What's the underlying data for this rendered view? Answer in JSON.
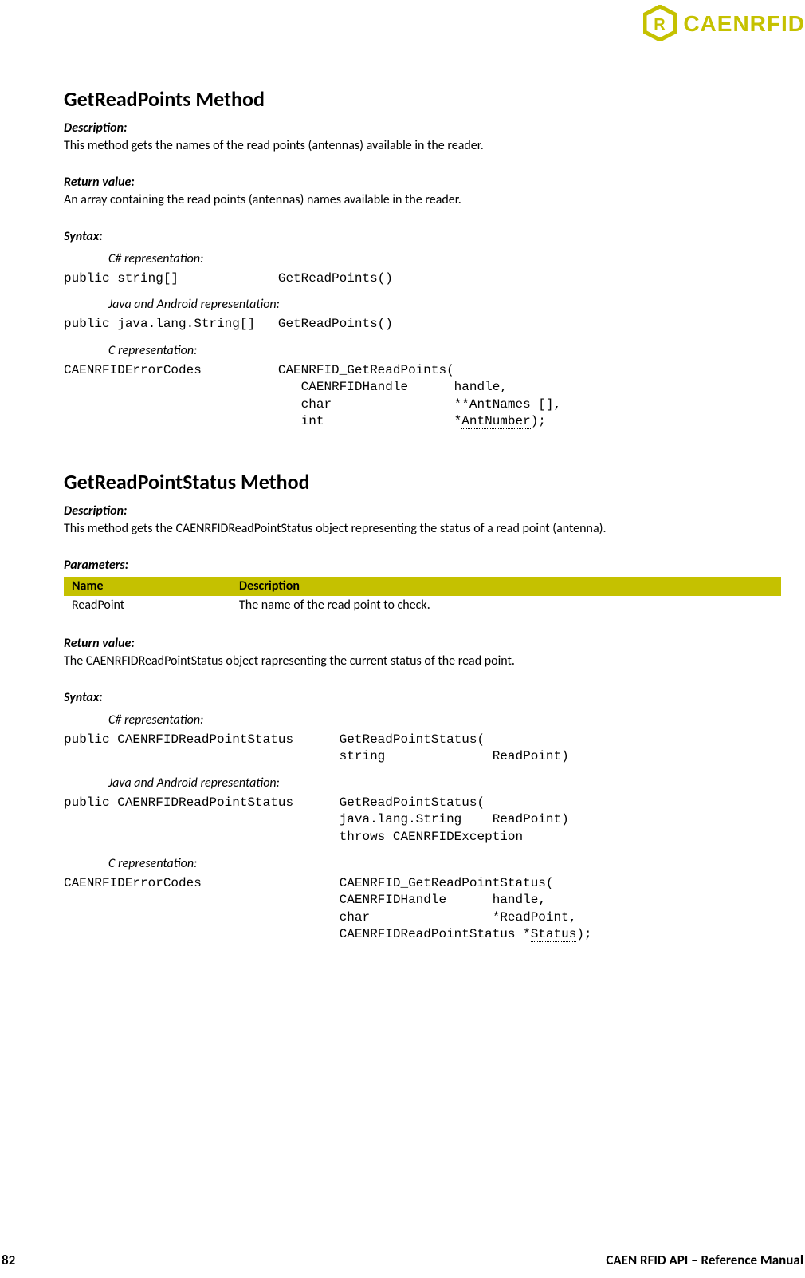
{
  "branding": {
    "logo_icon": "hex-r-icon",
    "brand_text": "CAENRFID",
    "brand_color": "#c5c100"
  },
  "sections": {
    "getReadPoints": {
      "title": "GetReadPoints Method",
      "description_label": "Description:",
      "description_text": "This method gets the names of the read points (antennas) available in the reader.",
      "return_label": "Return value:",
      "return_text": "An array containing the read points (antennas) names available in the reader.",
      "syntax_label": "Syntax:",
      "csharp_label": "C# representation:",
      "csharp_code": "public string[]             GetReadPoints()",
      "java_label": "Java and Android representation:",
      "java_code": "public java.lang.String[]   GetReadPoints()",
      "c_label": "C representation:",
      "c_code_l1": "CAENRFIDErrorCodes          CAENRFID_GetReadPoints(",
      "c_code_l2_pre": "                               CAENRFIDHandle      handle,",
      "c_code_l3_pre": "                               char                **",
      "c_code_l3_u": "AntNames []",
      "c_code_l3_post": ",",
      "c_code_l4_pre": "                               int                 *",
      "c_code_l4_u": "AntNumber",
      "c_code_l4_post": ");"
    },
    "getReadPointStatus": {
      "title": "GetReadPointStatus Method",
      "description_label": "Description:",
      "description_text": "This method gets the CAENRFIDReadPointStatus object representing the status of a read point (antenna).",
      "parameters_label": "Parameters:",
      "table": {
        "head_name": "Name",
        "head_desc": "Description",
        "rows": [
          {
            "name": "ReadPoint",
            "desc": "The name of the read point to check."
          }
        ]
      },
      "return_label": "Return value:",
      "return_text": "The CAENRFIDReadPointStatus object rapresenting the current status of the read point.",
      "syntax_label": "Syntax:",
      "csharp_label": "C# representation:",
      "csharp_code": "public CAENRFIDReadPointStatus      GetReadPointStatus(\n                                    string              ReadPoint)",
      "java_label": "Java and Android representation:",
      "java_code": "public CAENRFIDReadPointStatus      GetReadPointStatus(\n                                    java.lang.String    ReadPoint)\n                                    throws CAENRFIDException",
      "c_label": "C representation:",
      "c_code_l1": "CAENRFIDErrorCodes                  CAENRFID_GetReadPointStatus(",
      "c_code_l2": "                                    CAENRFIDHandle      handle,",
      "c_code_l3": "                                    char                *ReadPoint,",
      "c_code_l4_pre": "                                    CAENRFIDReadPointStatus *",
      "c_code_l4_u": "Status",
      "c_code_l4_post": ");"
    }
  },
  "footer": {
    "page_number": "82",
    "doc_title": "CAEN RFID API – Reference Manual"
  }
}
